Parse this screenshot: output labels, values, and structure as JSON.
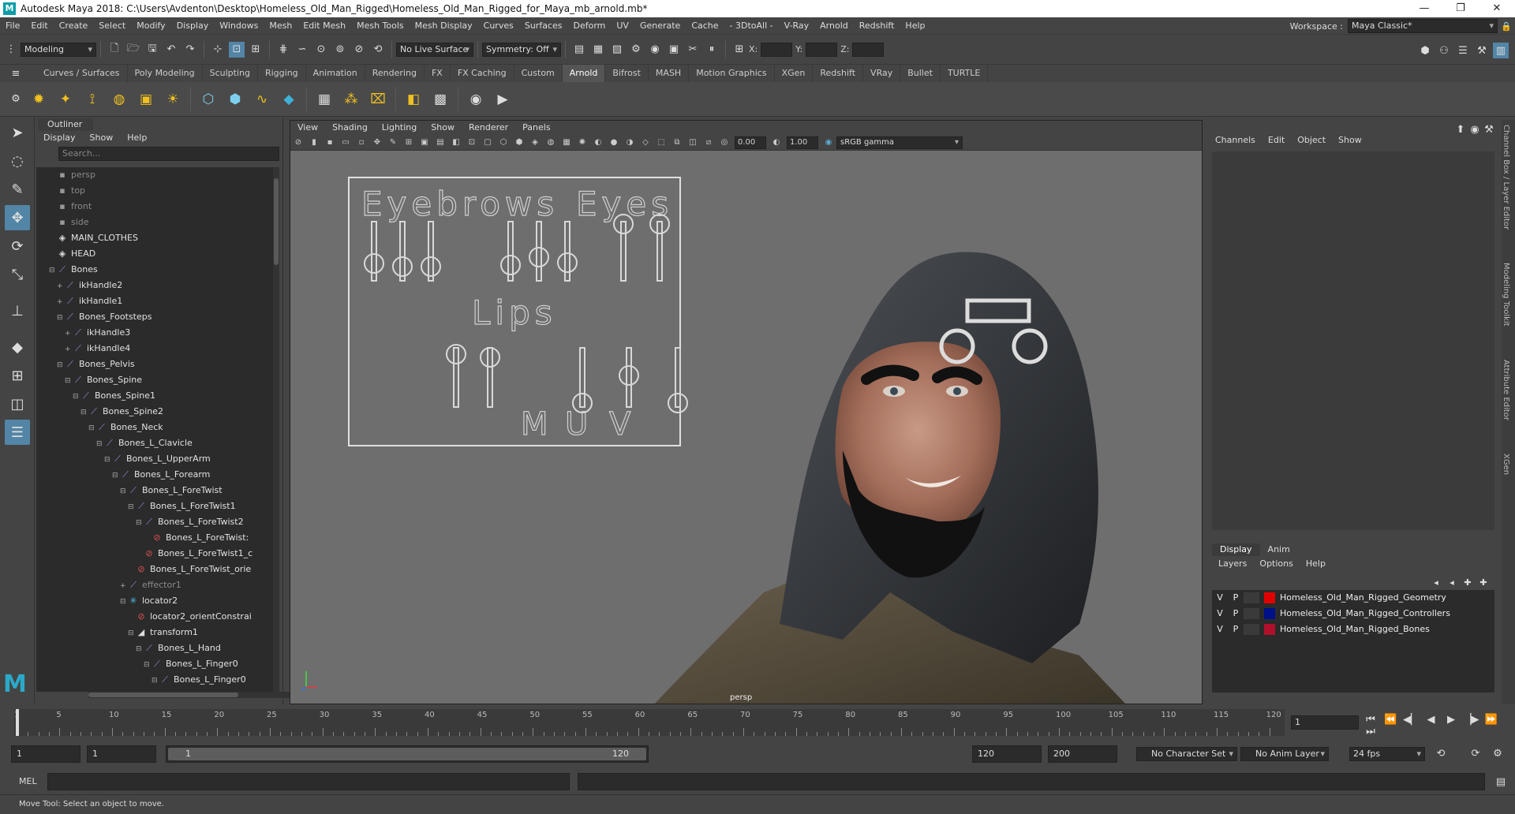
{
  "titlebar": {
    "title": "Autodesk Maya 2018: C:\\Users\\Avdenton\\Desktop\\Homeless_Old_Man_Rigged\\Homeless_Old_Man_Rigged_for_Maya_mb_arnold.mb*",
    "minimize": "—",
    "maximize": "❐",
    "close": "✕"
  },
  "menubar": {
    "items": [
      "File",
      "Edit",
      "Create",
      "Select",
      "Modify",
      "Display",
      "Windows",
      "Mesh",
      "Edit Mesh",
      "Mesh Tools",
      "Mesh Display",
      "Curves",
      "Surfaces",
      "Deform",
      "UV",
      "Generate",
      "Cache",
      "- 3DtoAll -",
      "V-Ray",
      "Arnold",
      "Redshift",
      "Help"
    ],
    "workspace_label": "Workspace :",
    "workspace_value": "Maya Classic*"
  },
  "statusline": {
    "mode": "Modeling",
    "live_surface": "No Live Surface",
    "symmetry": "Symmetry: Off",
    "x_label": "X:",
    "y_label": "Y:",
    "z_label": "Z:"
  },
  "shelf": {
    "tabs": [
      "Curves / Surfaces",
      "Poly Modeling",
      "Sculpting",
      "Rigging",
      "Animation",
      "Rendering",
      "FX",
      "FX Caching",
      "Custom",
      "Arnold",
      "Bifrost",
      "MASH",
      "Motion Graphics",
      "XGen",
      "Redshift",
      "VRay",
      "Bullet",
      "TURTLE"
    ],
    "active_tab": "Arnold"
  },
  "outliner": {
    "title": "Outliner",
    "menu": [
      "Display",
      "Show",
      "Help"
    ],
    "search_placeholder": "Search...",
    "items": [
      {
        "label": "persp",
        "indent": 0,
        "icon": "camera-icon",
        "glyph": "▪",
        "cls": "cam",
        "dim": true,
        "exp": ""
      },
      {
        "label": "top",
        "indent": 0,
        "icon": "camera-icon",
        "glyph": "▪",
        "cls": "cam",
        "dim": true,
        "exp": ""
      },
      {
        "label": "front",
        "indent": 0,
        "icon": "camera-icon",
        "glyph": "▪",
        "cls": "cam",
        "dim": true,
        "exp": ""
      },
      {
        "label": "side",
        "indent": 0,
        "icon": "camera-icon",
        "glyph": "▪",
        "cls": "cam",
        "dim": true,
        "exp": ""
      },
      {
        "label": "MAIN_CLOTHES",
        "indent": 0,
        "icon": "group-icon",
        "glyph": "◈",
        "cls": "grp",
        "dim": false,
        "exp": ""
      },
      {
        "label": "HEAD",
        "indent": 0,
        "icon": "group-icon",
        "glyph": "◈",
        "cls": "grp",
        "dim": false,
        "exp": ""
      },
      {
        "label": "Bones",
        "indent": 0,
        "icon": "joint-icon",
        "glyph": "⟋",
        "cls": "",
        "dim": false,
        "exp": "⊟"
      },
      {
        "label": "ikHandle2",
        "indent": 1,
        "icon": "ik-handle-icon",
        "glyph": "⟋",
        "cls": "",
        "dim": false,
        "exp": "+"
      },
      {
        "label": "ikHandle1",
        "indent": 1,
        "icon": "ik-handle-icon",
        "glyph": "⟋",
        "cls": "",
        "dim": false,
        "exp": "+"
      },
      {
        "label": "Bones_Footsteps",
        "indent": 1,
        "icon": "joint-icon",
        "glyph": "⟋",
        "cls": "",
        "dim": false,
        "exp": "⊟"
      },
      {
        "label": "ikHandle3",
        "indent": 2,
        "icon": "ik-handle-icon",
        "glyph": "⟋",
        "cls": "",
        "dim": false,
        "exp": "+"
      },
      {
        "label": "ikHandle4",
        "indent": 2,
        "icon": "ik-handle-icon",
        "glyph": "⟋",
        "cls": "",
        "dim": false,
        "exp": "+"
      },
      {
        "label": "Bones_Pelvis",
        "indent": 1,
        "icon": "joint-icon",
        "glyph": "⟋",
        "cls": "",
        "dim": false,
        "exp": "⊟"
      },
      {
        "label": "Bones_Spine",
        "indent": 2,
        "icon": "joint-icon",
        "glyph": "⟋",
        "cls": "",
        "dim": false,
        "exp": "⊟"
      },
      {
        "label": "Bones_Spine1",
        "indent": 3,
        "icon": "joint-icon",
        "glyph": "⟋",
        "cls": "",
        "dim": false,
        "exp": "⊟"
      },
      {
        "label": "Bones_Spine2",
        "indent": 4,
        "icon": "joint-icon",
        "glyph": "⟋",
        "cls": "",
        "dim": false,
        "exp": "⊟"
      },
      {
        "label": "Bones_Neck",
        "indent": 5,
        "icon": "joint-icon",
        "glyph": "⟋",
        "cls": "",
        "dim": false,
        "exp": "⊟"
      },
      {
        "label": "Bones_L_Clavicle",
        "indent": 6,
        "icon": "joint-icon",
        "glyph": "⟋",
        "cls": "",
        "dim": false,
        "exp": "⊟"
      },
      {
        "label": "Bones_L_UpperArm",
        "indent": 7,
        "icon": "joint-icon",
        "glyph": "⟋",
        "cls": "",
        "dim": false,
        "exp": "⊟"
      },
      {
        "label": "Bones_L_Forearm",
        "indent": 8,
        "icon": "joint-icon",
        "glyph": "⟋",
        "cls": "",
        "dim": false,
        "exp": "⊟"
      },
      {
        "label": "Bones_L_ForeTwist",
        "indent": 9,
        "icon": "joint-icon",
        "glyph": "⟋",
        "cls": "",
        "dim": false,
        "exp": "⊟"
      },
      {
        "label": "Bones_L_ForeTwist1",
        "indent": 10,
        "icon": "joint-icon",
        "glyph": "⟋",
        "cls": "",
        "dim": false,
        "exp": "⊟"
      },
      {
        "label": "Bones_L_ForeTwist2",
        "indent": 11,
        "icon": "joint-icon",
        "glyph": "⟋",
        "cls": "",
        "dim": false,
        "exp": "⊟"
      },
      {
        "label": "Bones_L_ForeTwist:",
        "indent": 12,
        "icon": "constraint-icon",
        "glyph": "⊘",
        "cls": "red",
        "dim": false,
        "exp": ""
      },
      {
        "label": "Bones_L_ForeTwist1_c",
        "indent": 11,
        "icon": "constraint-icon",
        "glyph": "⊘",
        "cls": "red",
        "dim": false,
        "exp": ""
      },
      {
        "label": "Bones_L_ForeTwist_orie",
        "indent": 10,
        "icon": "constraint-icon",
        "glyph": "⊘",
        "cls": "red",
        "dim": false,
        "exp": ""
      },
      {
        "label": "effector1",
        "indent": 9,
        "icon": "effector-icon",
        "glyph": "⟋",
        "cls": "",
        "dim": true,
        "exp": "+"
      },
      {
        "label": "locator2",
        "indent": 9,
        "icon": "locator-icon",
        "glyph": "✳",
        "cls": "cy",
        "dim": false,
        "exp": "⊟"
      },
      {
        "label": "locator2_orientConstrai",
        "indent": 10,
        "icon": "constraint-icon",
        "glyph": "⊘",
        "cls": "red",
        "dim": false,
        "exp": ""
      },
      {
        "label": "transform1",
        "indent": 10,
        "icon": "transform-icon",
        "glyph": "◢",
        "cls": "grp",
        "dim": false,
        "exp": "⊟"
      },
      {
        "label": "Bones_L_Hand",
        "indent": 11,
        "icon": "joint-icon",
        "glyph": "⟋",
        "cls": "",
        "dim": false,
        "exp": "⊟"
      },
      {
        "label": "Bones_L_Finger0",
        "indent": 12,
        "icon": "joint-icon",
        "glyph": "⟋",
        "cls": "",
        "dim": false,
        "exp": "⊟"
      },
      {
        "label": "Bones_L_Finger0",
        "indent": 13,
        "icon": "joint-icon",
        "glyph": "⟋",
        "cls": "",
        "dim": false,
        "exp": "⊟"
      }
    ]
  },
  "viewport": {
    "menu": [
      "View",
      "Shading",
      "Lighting",
      "Show",
      "Renderer",
      "Panels"
    ],
    "exposure": "0.00",
    "gamma": "1.00",
    "colorspace": "sRGB gamma",
    "camera_label": "persp",
    "rig_panel": {
      "eyebrows": "Eyebrows",
      "eyes": "Eyes",
      "lips": "Lips",
      "m": "M",
      "u": "U",
      "v": "V"
    }
  },
  "channelbox": {
    "menu": [
      "Channels",
      "Edit",
      "Object",
      "Show"
    ],
    "layer_tabs": [
      "Display",
      "Anim"
    ],
    "active_layer_tab": "Display",
    "layer_menu": [
      "Layers",
      "Options",
      "Help"
    ],
    "layers": [
      {
        "v": "V",
        "p": "P",
        "name": "Homeless_Old_Man_Rigged_Geometry",
        "color": "#e00000"
      },
      {
        "v": "V",
        "p": "P",
        "name": "Homeless_Old_Man_Rigged_Controllers",
        "color": "#00108a"
      },
      {
        "v": "V",
        "p": "P",
        "name": "Homeless_Old_Man_Rigged_Bones",
        "color": "#b0102a"
      }
    ]
  },
  "sidetabs": [
    "Channel Box / Layer Editor",
    "Modeling Toolkit",
    "Attribute Editor",
    "XGen"
  ],
  "timeslider": {
    "ticks": [
      1,
      5,
      10,
      15,
      20,
      25,
      30,
      35,
      40,
      45,
      50,
      55,
      60,
      65,
      70,
      75,
      80,
      85,
      90,
      95,
      100,
      105,
      110,
      115,
      120
    ],
    "current_frame": "1"
  },
  "range": {
    "start": "1",
    "playback_start": "1",
    "slider_start": "1",
    "slider_end": "120",
    "playback_end": "120",
    "end": "200",
    "character_set": "No Character Set",
    "anim_layer": "No Anim Layer",
    "fps": "24 fps"
  },
  "cmdline": {
    "label": "MEL"
  },
  "status": {
    "help_line": "Move Tool: Select an object to move."
  },
  "colors": {
    "accent": "#5285a6",
    "maya_logo": "#2aa9c9"
  }
}
